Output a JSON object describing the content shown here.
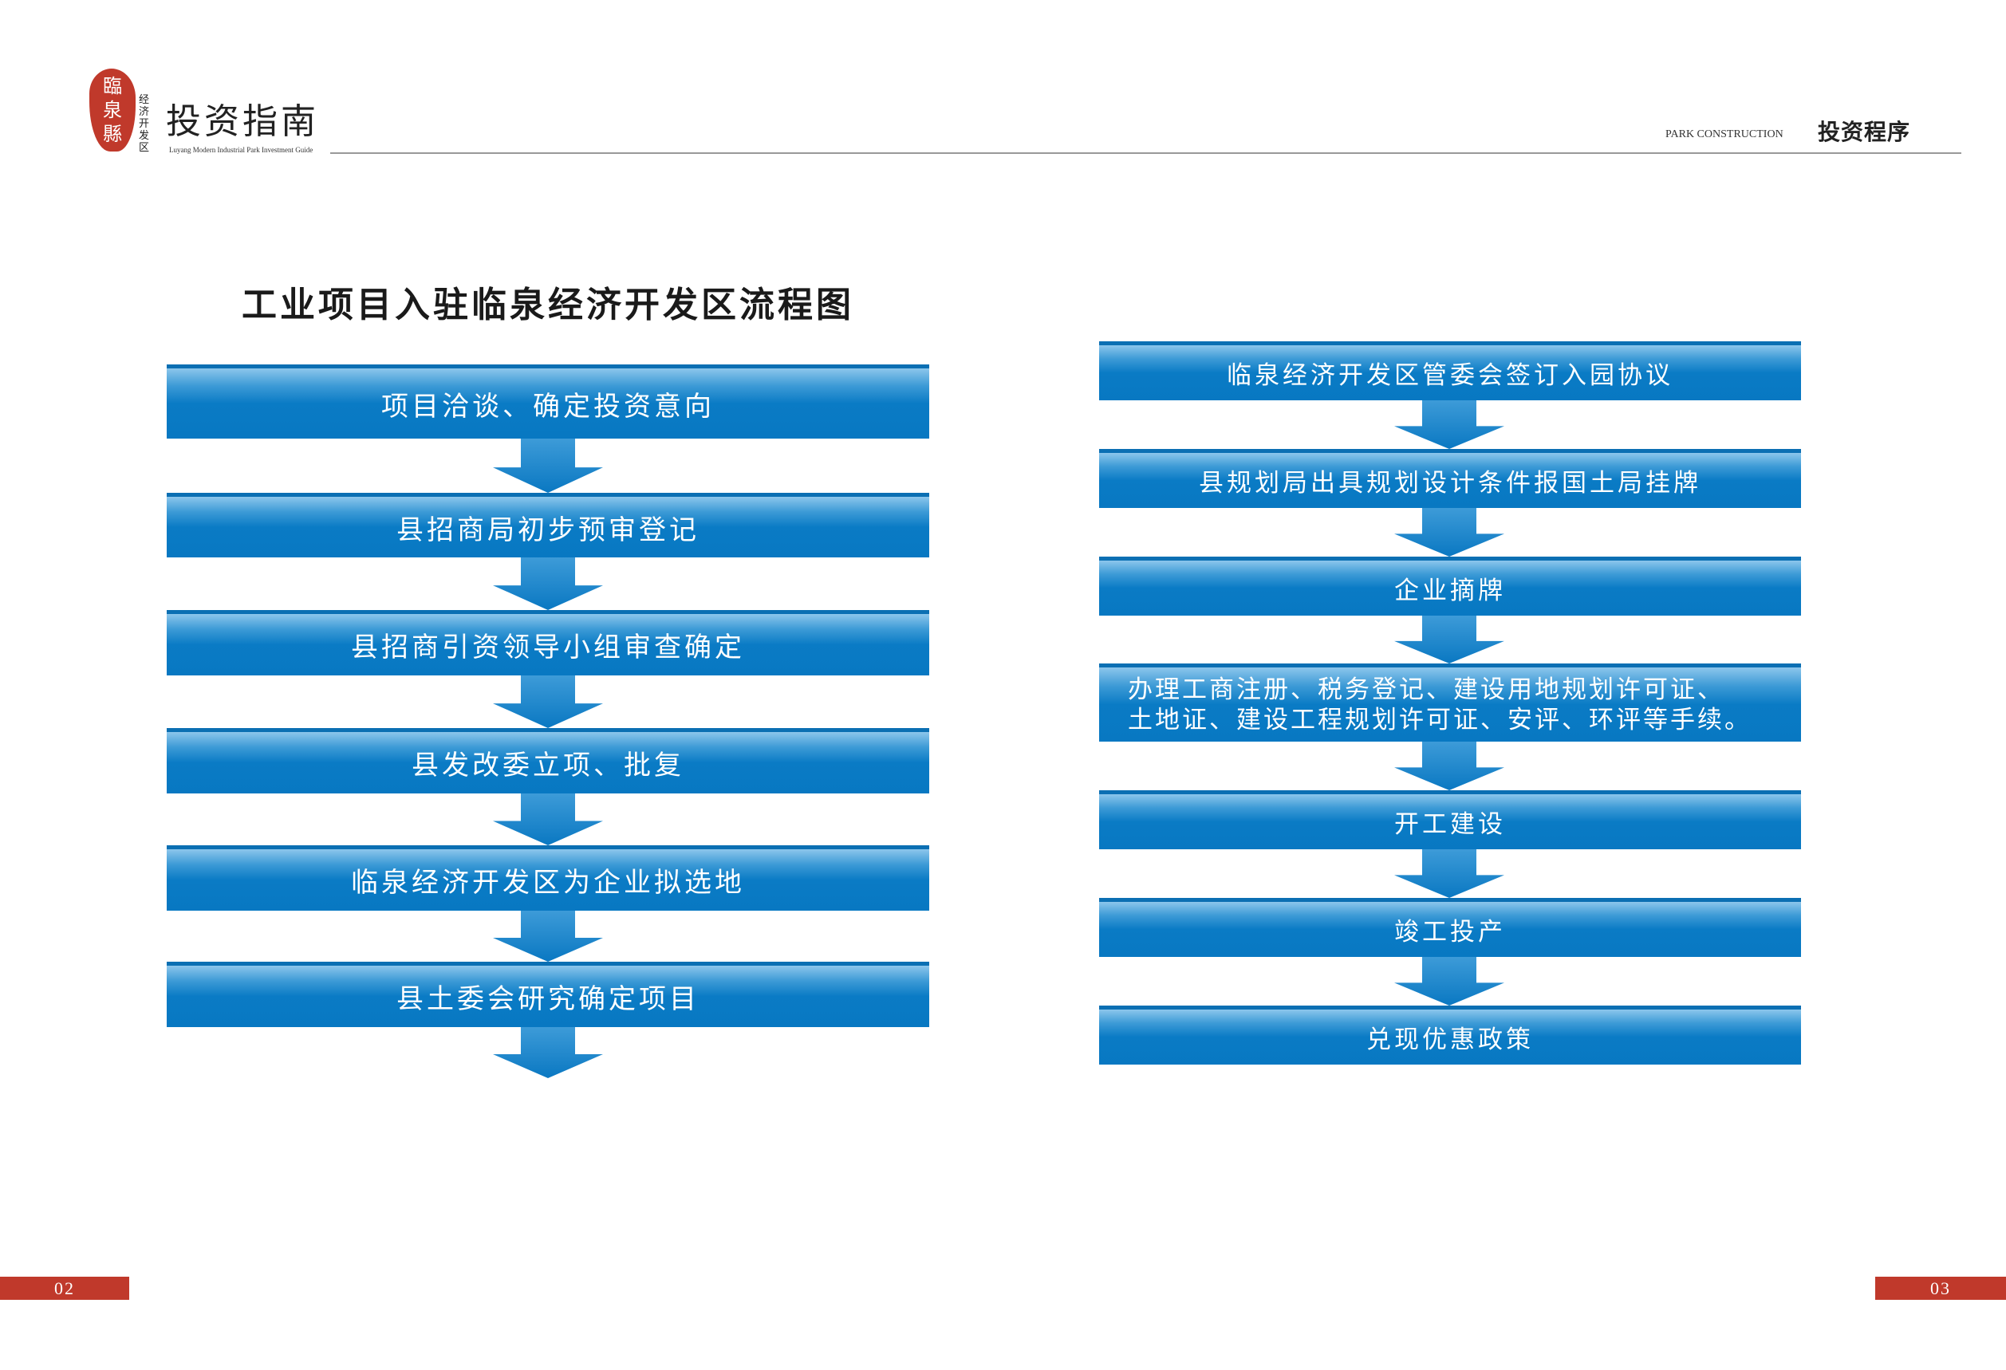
{
  "header": {
    "logo_seal_text": [
      "臨",
      "泉",
      "縣"
    ],
    "logo_vertical_text": [
      "经",
      "济",
      "开",
      "发",
      "区"
    ],
    "brand_title": "投资指南",
    "brand_subtitle": "Luyang Modern Industrial Park Investment Guide",
    "section_en": "PARK CONSTRUCTION",
    "section_cn": "投资程序"
  },
  "title": "工业项目入驻临泉经济开发区流程图",
  "left_steps": [
    "项目洽谈、确定投资意向",
    "县招商局初步预审登记",
    "县招商引资领导小组审查确定",
    "县发改委立项、批复",
    "临泉经济开发区为企业拟选地",
    "县土委会研究确定项目"
  ],
  "right_steps": [
    "临泉经济开发区管委会签订入园协议",
    "县规划局出具规划设计条件报国土局挂牌",
    "企业摘牌",
    [
      "办理工商注册、税务登记、建设用地规划许可证、",
      "土地证、建设工程规划许可证、安评、环评等手续。"
    ],
    "开工建设",
    "竣工投产",
    "兑现优惠政策"
  ],
  "footer": {
    "page_left": "02",
    "page_right": "03"
  },
  "colors": {
    "box_blue": "#0878c2",
    "box_top": "#0b6fb3",
    "accent_red": "#c0392b"
  }
}
